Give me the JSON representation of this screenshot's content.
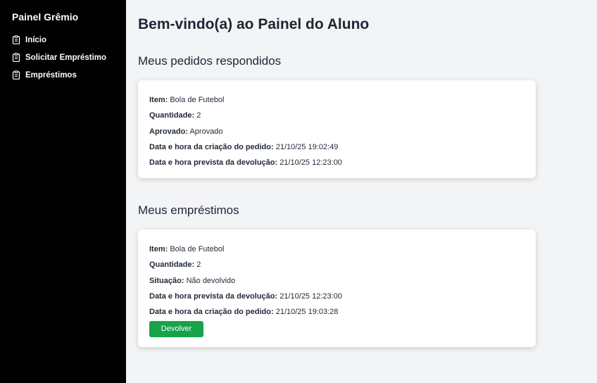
{
  "sidebar": {
    "brand": "Painel Grêmio",
    "items": [
      {
        "label": "Início",
        "icon": "clipboard-icon"
      },
      {
        "label": "Solicitar Empréstimo",
        "icon": "clipboard-icon"
      },
      {
        "label": "Empréstimos",
        "icon": "clipboard-icon"
      }
    ]
  },
  "main": {
    "title": "Bem-vindo(a) ao Painel do Aluno",
    "requests": {
      "title": "Meus pedidos respondidos",
      "card": {
        "item_label": "Item:",
        "item_value": "Bola de Futebol",
        "qty_label": "Quantidade:",
        "qty_value": "2",
        "approved_label": "Aprovado:",
        "approved_value": "Aprovado",
        "created_label": "Data e hora da criação do pedido:",
        "created_value": "21/10/25 19:02:49",
        "return_label": "Data e hora prevista da devolução:",
        "return_value": "21/10/25 12:23:00"
      }
    },
    "loans": {
      "title": "Meus empréstimos",
      "card": {
        "item_label": "Item:",
        "item_value": "Bola de Futebol",
        "qty_label": "Quantidade:",
        "qty_value": "2",
        "status_label": "Situação:",
        "status_value": "Não devolvido",
        "return_label": "Data e hora prevista da devolução:",
        "return_value": "21/10/25 12:23:00",
        "created_label": "Data e hora da criação do pedido:",
        "created_value": "21/10/25 19:03:28",
        "return_button": "Devolver"
      }
    }
  },
  "colors": {
    "sidebar_bg": "#000000",
    "page_bg": "#f3f4f6",
    "button_bg": "#16a34a"
  }
}
